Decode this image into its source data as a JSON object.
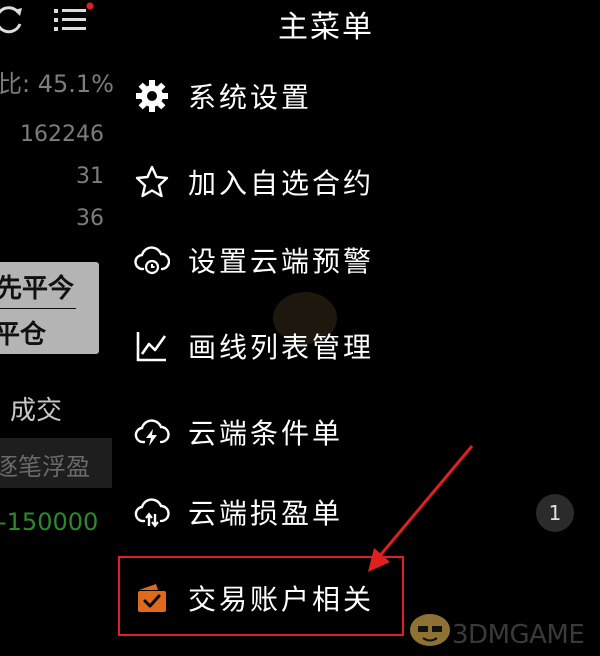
{
  "left_panel": {
    "ratio_text": "比: 45.1%",
    "stats": [
      "162246",
      "31",
      "36"
    ],
    "close_today": "先平今",
    "close_position": "平仓",
    "filled_label": "成交",
    "float_pnl_label": "逐笔浮盈",
    "pnl_value": "-150000"
  },
  "menu": {
    "title": "主菜单",
    "items": [
      {
        "label": "系统设置",
        "icon": "gear-icon"
      },
      {
        "label": "加入自选合约",
        "icon": "star-icon"
      },
      {
        "label": "设置云端预警",
        "icon": "cloud-alarm-icon"
      },
      {
        "label": "画线列表管理",
        "icon": "line-chart-icon"
      },
      {
        "label": "云端条件单",
        "icon": "cloud-lightning-icon"
      },
      {
        "label": "云端损盈单",
        "icon": "cloud-stop-icon"
      },
      {
        "label": "交易账户相关",
        "icon": "account-folder-icon"
      }
    ],
    "badge_count": "1"
  },
  "watermark": {
    "brand_text": "3DMGAME"
  },
  "colors": {
    "highlight": "#e02020",
    "account_icon": "#e06a1c",
    "pnl_green": "#2a8a2a"
  }
}
